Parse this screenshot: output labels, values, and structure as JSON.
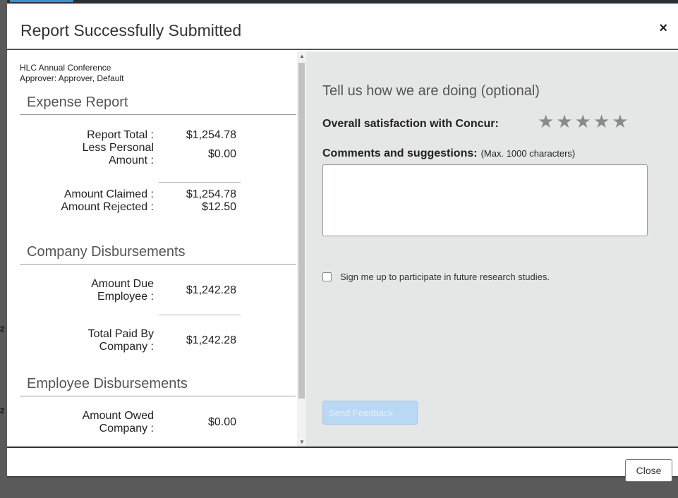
{
  "dialog": {
    "title": "Report Successfully Submitted",
    "close_icon": "×",
    "close_button_label": "Close"
  },
  "report": {
    "name": "HLC Annual Conference",
    "approver": "Approver: Approver, Default"
  },
  "expense_report": {
    "title": "Expense Report",
    "report_total_label": "Report Total :",
    "report_total_value": "$1,254.78",
    "less_personal_label_1": "Less Personal",
    "less_personal_label_2": "Amount :",
    "less_personal_value": "$0.00",
    "amount_claimed_label": "Amount Claimed :",
    "amount_claimed_value": "$1,254.78",
    "amount_rejected_label": "Amount Rejected :",
    "amount_rejected_value": "$12.50"
  },
  "company_disbursements": {
    "title": "Company Disbursements",
    "amount_due_label_1": "Amount Due",
    "amount_due_label_2": "Employee :",
    "amount_due_value": "$1,242.28",
    "total_paid_label_1": "Total Paid By",
    "total_paid_label_2": "Company :",
    "total_paid_value": "$1,242.28"
  },
  "employee_disbursements": {
    "title": "Employee Disbursements",
    "amount_owed_label_1": "Amount Owed",
    "amount_owed_label_2": "Company :",
    "amount_owed_value": "$0.00"
  },
  "feedback": {
    "heading": "Tell us how we are doing (optional)",
    "satisfaction_label": "Overall satisfaction with Concur:",
    "rating": 0,
    "rating_max": 5,
    "star_glyph": "★",
    "comments_label": "Comments and suggestions:",
    "comments_hint": "(Max. 1000 characters)",
    "comments_value": "",
    "research_label": "Sign me up to participate in future research studies.",
    "research_checked": false,
    "send_label": "Send Feedback"
  },
  "background_fragments": [
    "2",
    "2"
  ],
  "colors": {
    "accent": "#3d8fd6",
    "send_button_disabled": "#b9d8f3",
    "feedback_panel": "#e5e6e6",
    "star_inactive": "#8a8a8a"
  }
}
